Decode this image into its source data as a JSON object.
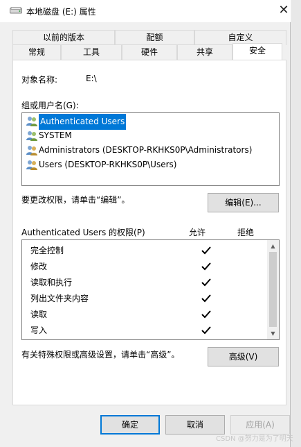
{
  "window": {
    "title": "本地磁盘 (E:) 属性",
    "close_icon": "close-icon"
  },
  "tabs": {
    "row1": [
      {
        "label": "以前的版本"
      },
      {
        "label": "配额"
      },
      {
        "label": "自定义"
      }
    ],
    "row2": [
      {
        "label": "常规"
      },
      {
        "label": "工具"
      },
      {
        "label": "硬件"
      },
      {
        "label": "共享"
      },
      {
        "label": "安全",
        "active": true
      }
    ]
  },
  "security": {
    "object_name_label": "对象名称:",
    "object_name_value": "E:\\",
    "group_label": "组或用户名(G):",
    "users": [
      {
        "name": "Authenticated Users",
        "selected": true
      },
      {
        "name": "SYSTEM"
      },
      {
        "name": "Administrators (DESKTOP-RKHKS0P\\Administrators)"
      },
      {
        "name": "Users (DESKTOP-RKHKS0P\\Users)"
      }
    ],
    "edit_hint": "要更改权限，请单击“编辑”。",
    "edit_button": "编辑(E)...",
    "perm_title": "Authenticated Users 的权限(P)",
    "allow_header": "允许",
    "deny_header": "拒绝",
    "permissions": [
      {
        "name": "完全控制",
        "allow": true,
        "deny": false
      },
      {
        "name": "修改",
        "allow": true,
        "deny": false
      },
      {
        "name": "读取和执行",
        "allow": true,
        "deny": false
      },
      {
        "name": "列出文件夹内容",
        "allow": true,
        "deny": false
      },
      {
        "name": "读取",
        "allow": true,
        "deny": false
      },
      {
        "name": "写入",
        "allow": true,
        "deny": false
      }
    ],
    "advanced_hint": "有关特殊权限或高级设置，请单击“高级”。",
    "advanced_button": "高级(V)"
  },
  "footer": {
    "ok": "确定",
    "cancel": "取消",
    "apply": "应用(A)"
  },
  "watermark": "CSDN @努力是为了明天",
  "colors": {
    "selection": "#0078d7",
    "default_button_border": "#0078d7"
  }
}
